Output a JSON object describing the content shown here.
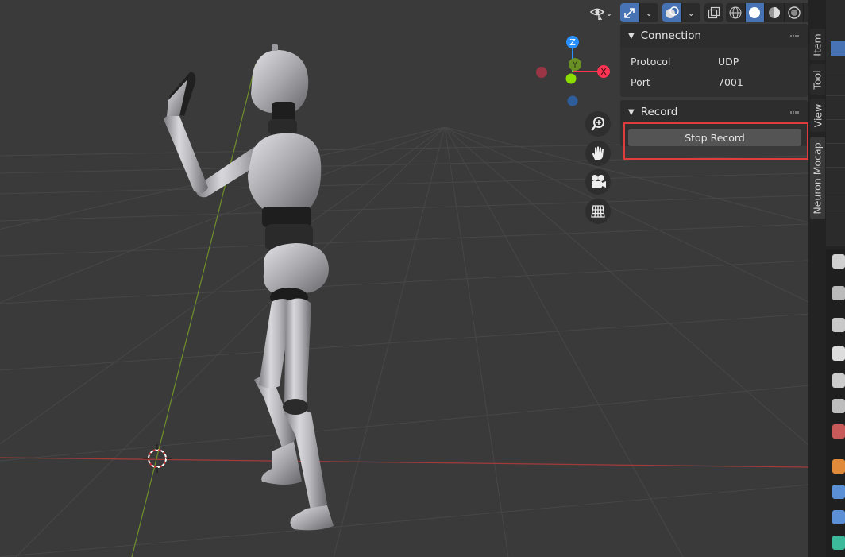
{
  "viewport": {
    "header": {
      "visibility_icon": "eye-arrow-icon",
      "gizmo_icon": "gizmo-arrows-icon",
      "overlay_icon": "overlay-circles-icon",
      "xray_icon": "xray-icon",
      "shading_modes": [
        "wireframe-icon",
        "solid-icon",
        "material-preview-icon",
        "rendered-icon"
      ],
      "active_shading": "solid"
    },
    "gizmo": {
      "z_label": "Z",
      "y_label": "Y",
      "x_label": "X"
    },
    "navigation": [
      "zoom-icon",
      "pan-hand-icon",
      "camera-icon",
      "ortho-grid-icon"
    ]
  },
  "npanel": {
    "connection": {
      "title": "Connection",
      "rows": [
        {
          "key": "Protocol",
          "value": "UDP"
        },
        {
          "key": "Port",
          "value": "7001"
        }
      ]
    },
    "record": {
      "title": "Record",
      "button_label": "Stop Record"
    },
    "tabs": [
      "Item",
      "Tool",
      "View",
      "Neuron Mocap"
    ],
    "active_tab": "Neuron Mocap"
  },
  "colors": {
    "accent": "#4772b3",
    "highlight_border": "#e03c3c",
    "axis_x": "#ff3352",
    "axis_y": "#8bdc00",
    "axis_z": "#2890ff"
  }
}
